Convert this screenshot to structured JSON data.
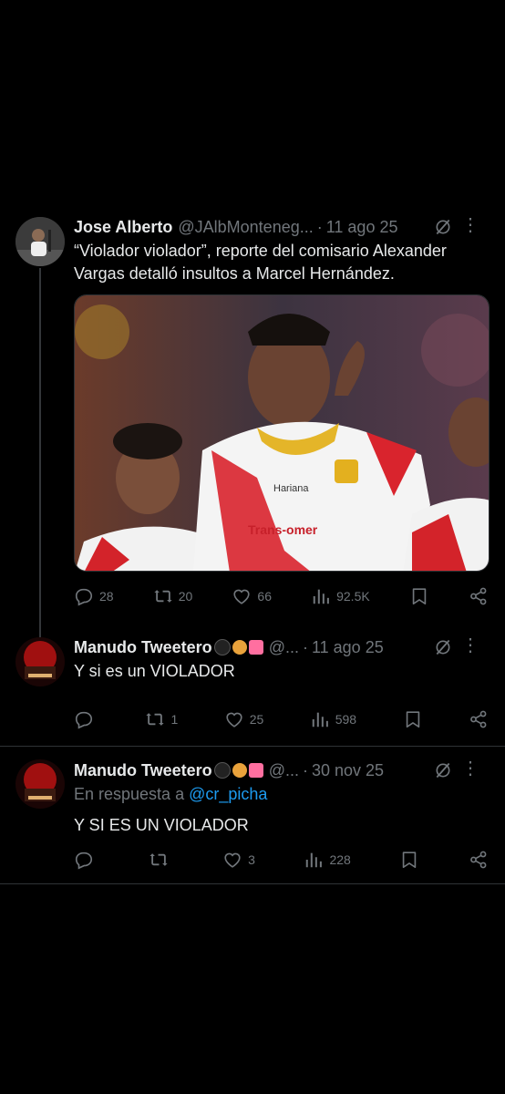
{
  "tweets": [
    {
      "name": "Jose Alberto",
      "handle": "@JAlbMonteneg...",
      "time": "11 ago 25",
      "text": "“Violador violador”, reporte del comisario Alexander Vargas detalló insultos a Marcel Hernández.",
      "media_sponsor_1": "Hariana",
      "media_sponsor_2": "Trans-omer",
      "stats": {
        "replies": "28",
        "retweets": "20",
        "likes": "66",
        "views": "92.5K"
      }
    },
    {
      "name": "Manudo Tweetero",
      "handle": "@...",
      "time": "11 ago 25",
      "text": "Y si es un VIOLADOR",
      "stats": {
        "replies": "",
        "retweets": "1",
        "likes": "25",
        "views": "598"
      }
    },
    {
      "name": "Manudo Tweetero",
      "handle": "@...",
      "time": "30 nov 25",
      "reply_prefix": "En respuesta a",
      "reply_handle": "@cr_picha",
      "text": "Y SI ES UN VIOLADOR",
      "stats": {
        "replies": "",
        "retweets": "",
        "likes": "3",
        "views": "228"
      }
    }
  ],
  "icons": {
    "reply": "reply-icon",
    "retweet": "retweet-icon",
    "like": "heart-icon",
    "views": "views-icon",
    "bookmark": "bookmark-icon",
    "share": "share-icon",
    "grok": "grok-icon",
    "more": "more-icon"
  },
  "colors": {
    "background": "#000000",
    "text": "#e7e9ea",
    "muted": "#71767b",
    "link": "#1d9bf0",
    "divider": "#2f3336"
  }
}
